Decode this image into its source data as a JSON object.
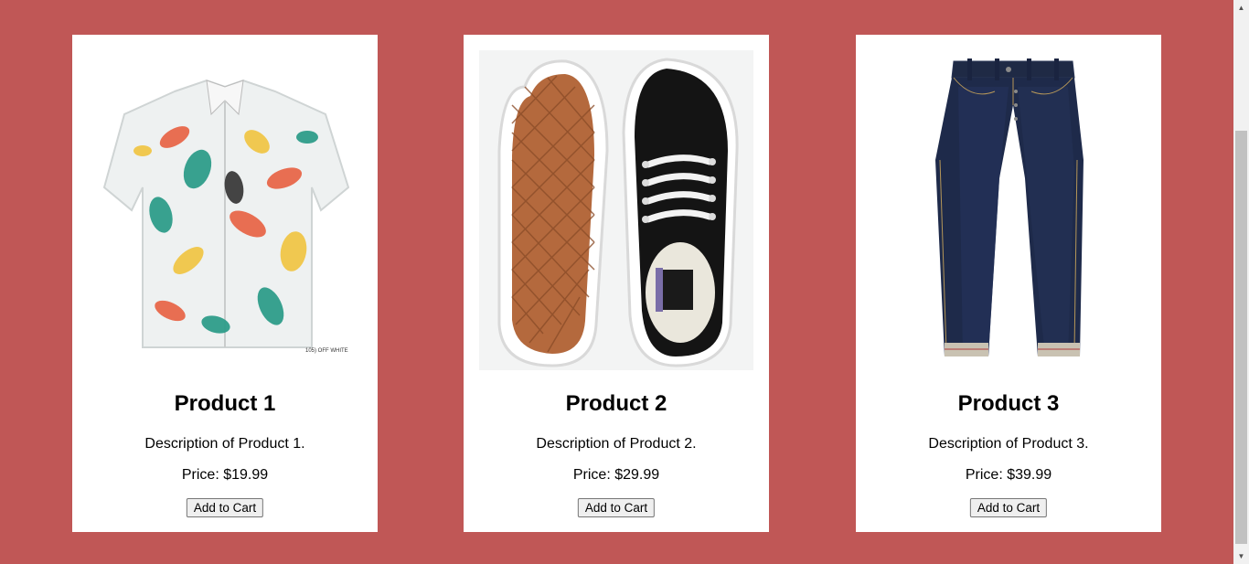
{
  "products": [
    {
      "title": "Product 1",
      "description": "Description of Product 1.",
      "price": "Price: $19.99",
      "button_label": "Add to Cart",
      "image_icon": "hawaiian-shirt-image",
      "image_caption": "105) OFF WHITE"
    },
    {
      "title": "Product 2",
      "description": "Description of Product 2.",
      "price": "Price: $29.99",
      "button_label": "Add to Cart",
      "image_icon": "sneakers-image"
    },
    {
      "title": "Product 3",
      "description": "Description of Product 3.",
      "price": "Price: $39.99",
      "button_label": "Add to Cart",
      "image_icon": "jeans-image"
    }
  ],
  "colors": {
    "background": "#c05756",
    "card": "#ffffff"
  }
}
